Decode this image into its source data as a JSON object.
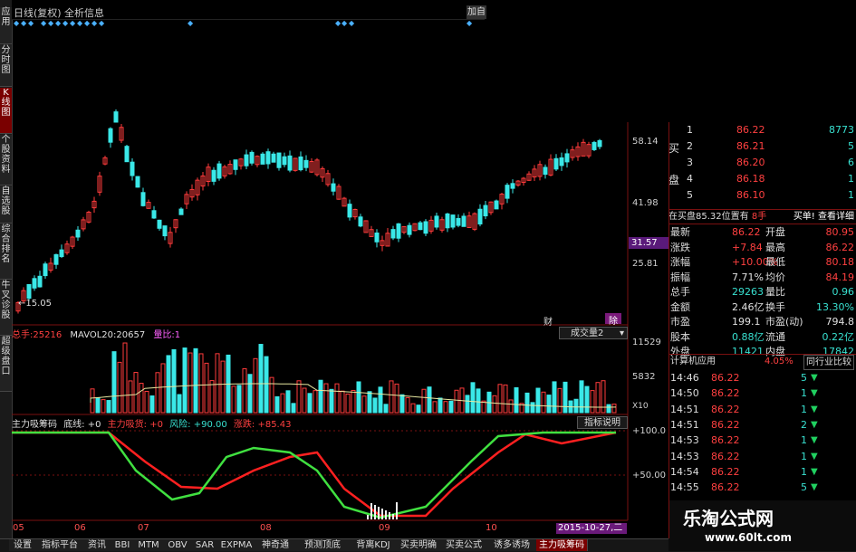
{
  "sidebar": {
    "tabs": [
      "应用",
      "分时图",
      "K线图",
      "个股资料",
      "自选股",
      "综合排名",
      "牛叉诊股",
      "超级盘口"
    ],
    "active": 2
  },
  "topbar": {
    "chart_mode": "日线(复权)",
    "info_tab": "全析信息",
    "add_button": "加自"
  },
  "price_axis": {
    "labels": [
      "58.14",
      "41.98",
      "25.81"
    ],
    "current_price": "31.57",
    "low_marker": "15.05",
    "fin_flag": "财",
    "plan_flag": "除"
  },
  "volume_header": {
    "total_label": "总手:",
    "total_value": "25216",
    "mavol_label": "MAVOL20:",
    "mavol_value": "20657",
    "ratio_label": "量比:",
    "ratio_value": "1",
    "dropdown": "成交量2"
  },
  "volume_axis": {
    "labels": [
      "11529",
      "5832",
      "X10"
    ]
  },
  "indicator_header": {
    "name": "主力吸筹码",
    "baseline": "底线: +0",
    "inflow": "主力吸货: +0",
    "risk": "风险: +90.00",
    "change": "涨跌: +85.43",
    "explain_button": "指标说明"
  },
  "indicator_axis": {
    "labels": [
      "+100.0",
      "+50.00"
    ]
  },
  "date_axis": {
    "labels": [
      "05",
      "06",
      "07",
      "08",
      "09",
      "10"
    ],
    "current_date": "2015-10-27,二"
  },
  "order_book": {
    "sell_label": "买盘",
    "buy_label": "买盘",
    "rows": [
      {
        "level": "1",
        "price": "86.22",
        "volume": "8773"
      },
      {
        "level": "2",
        "price": "86.21",
        "volume": "5"
      },
      {
        "level": "3",
        "price": "86.20",
        "volume": "6"
      },
      {
        "level": "4",
        "price": "86.18",
        "volume": "1"
      },
      {
        "level": "5",
        "price": "86.10",
        "volume": "1"
      }
    ],
    "sell_side": "买",
    "sell_side2": "盘",
    "status": "在买盘85.32位置有",
    "status_qty": "8手",
    "action": "买单! 查看详细"
  },
  "quote": {
    "rows": [
      {
        "l1": "最新",
        "v1": "86.22",
        "l2": "开盘",
        "v2": "80.95"
      },
      {
        "l1": "涨跌",
        "v1": "+7.84",
        "l2": "最高",
        "v2": "86.22"
      },
      {
        "l1": "涨幅",
        "v1": "+10.00%",
        "l2": "最低",
        "v2": "80.18"
      },
      {
        "l1": "振幅",
        "v1": "7.71%",
        "l2": "均价",
        "v2": "84.19"
      },
      {
        "l1": "总手",
        "v1": "29263",
        "l2": "量比",
        "v2": "0.96"
      },
      {
        "l1": "金额",
        "v1": "2.46亿",
        "l2": "换手",
        "v2": "13.30%"
      },
      {
        "l1": "市盈",
        "v1": "199.1",
        "l2": "市盈(动)",
        "v2": "794.8"
      },
      {
        "l1": "股本",
        "v1": "0.88亿",
        "l2": "流通",
        "v2": "0.22亿"
      },
      {
        "l1": "外盘",
        "v1": "11421",
        "l2": "内盘",
        "v2": "17842"
      }
    ]
  },
  "sector": {
    "name": "计算机应用",
    "change": "4.05%",
    "compare": "同行业比较"
  },
  "ticks": [
    {
      "time": "14:46",
      "price": "86.22",
      "qty": "5"
    },
    {
      "time": "14:50",
      "price": "86.22",
      "qty": "1"
    },
    {
      "time": "14:51",
      "price": "86.22",
      "qty": "1"
    },
    {
      "time": "14:51",
      "price": "86.22",
      "qty": "2"
    },
    {
      "time": "14:53",
      "price": "86.22",
      "qty": "1"
    },
    {
      "time": "14:53",
      "price": "86.22",
      "qty": "1"
    },
    {
      "time": "14:54",
      "price": "86.22",
      "qty": "1"
    },
    {
      "time": "14:55",
      "price": "86.22",
      "qty": "5"
    }
  ],
  "bottom_tabs": [
    "设置",
    "指标平台",
    "资讯",
    "BBI",
    "MTM",
    "OBV",
    "SAR",
    "EXPMA",
    "神奇通",
    "预测顶底",
    "背离KDJ",
    "买卖明确",
    "买卖公式",
    "诱多诱场",
    "主力吸筹码"
  ],
  "bottom_active": 14,
  "watermark": {
    "title": "乐淘公式网",
    "url": "www.60lt.com"
  },
  "colors": {
    "up": "#ff3b3b",
    "down": "#3ae8e8",
    "ma": "#e8e8a0",
    "line_red": "#ff2020",
    "line_green": "#40e040"
  }
}
